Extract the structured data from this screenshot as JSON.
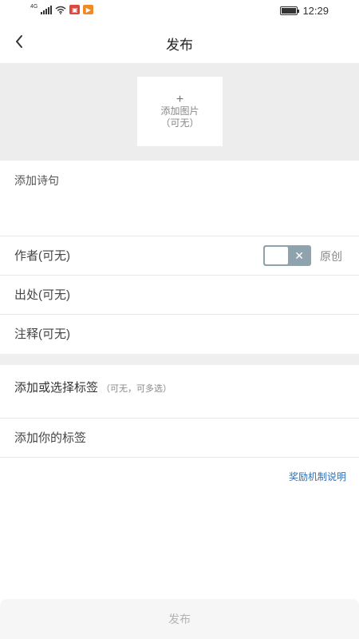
{
  "status_bar": {
    "signal_label": "4G",
    "time": "12:29",
    "battery_level": 0.95
  },
  "nav": {
    "title": "发布",
    "back_icon": "chevron-left-icon"
  },
  "image_upload": {
    "plus": "+",
    "label": "添加图片",
    "hint": "（可无）"
  },
  "poem": {
    "placeholder": "添加诗句"
  },
  "fields": {
    "author_placeholder": "作者(可无)",
    "source_placeholder": "出处(可无)",
    "notes_placeholder": "注释(可无)"
  },
  "original_toggle": {
    "label": "原创",
    "state": "off",
    "off_symbol": "✕"
  },
  "tags": {
    "title": "添加或选择标签",
    "hint": "（可无，可多选）",
    "your_tags_placeholder": "添加你的标签"
  },
  "reward_link": "奖励机制说明",
  "publish_button": "发布"
}
